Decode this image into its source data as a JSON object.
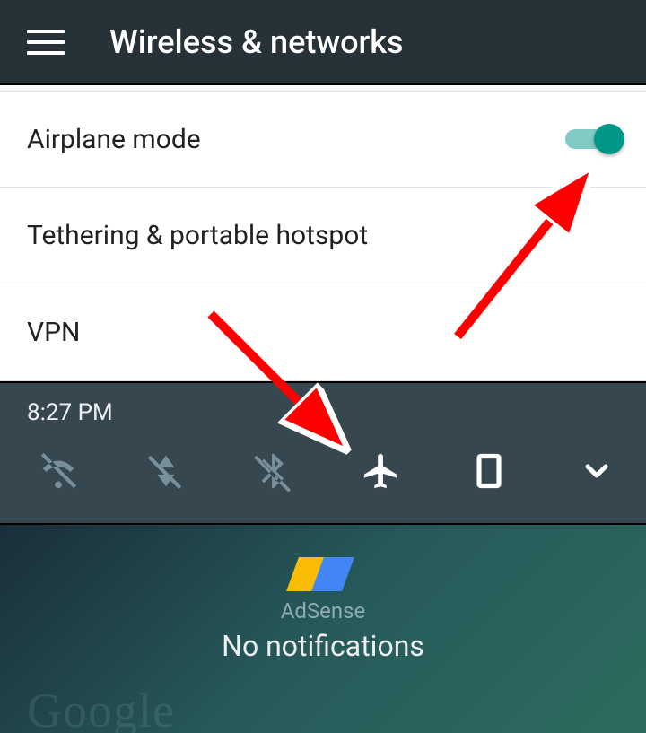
{
  "header": {
    "title": "Wireless & networks"
  },
  "settings": {
    "airplane_mode": {
      "label": "Airplane mode",
      "enabled": true
    },
    "tethering": {
      "label": "Tethering & portable hotspot"
    },
    "vpn": {
      "label": "VPN"
    }
  },
  "quick_settings": {
    "time": "8:27 PM",
    "icons": [
      "wifi-off",
      "mobile-data-off",
      "bluetooth-off",
      "airplane",
      "portrait-lock",
      "chevron-down"
    ]
  },
  "notifications": {
    "adsense_label": "AdSense",
    "empty_text": "No notifications",
    "watermark": "Google"
  },
  "annotations": {
    "arrow1": "points to airplane-mode toggle",
    "arrow2": "points to airplane quick-settings icon"
  },
  "colors": {
    "accent": "#009688",
    "header_bg": "#263238",
    "qs_bg": "#37474f"
  }
}
